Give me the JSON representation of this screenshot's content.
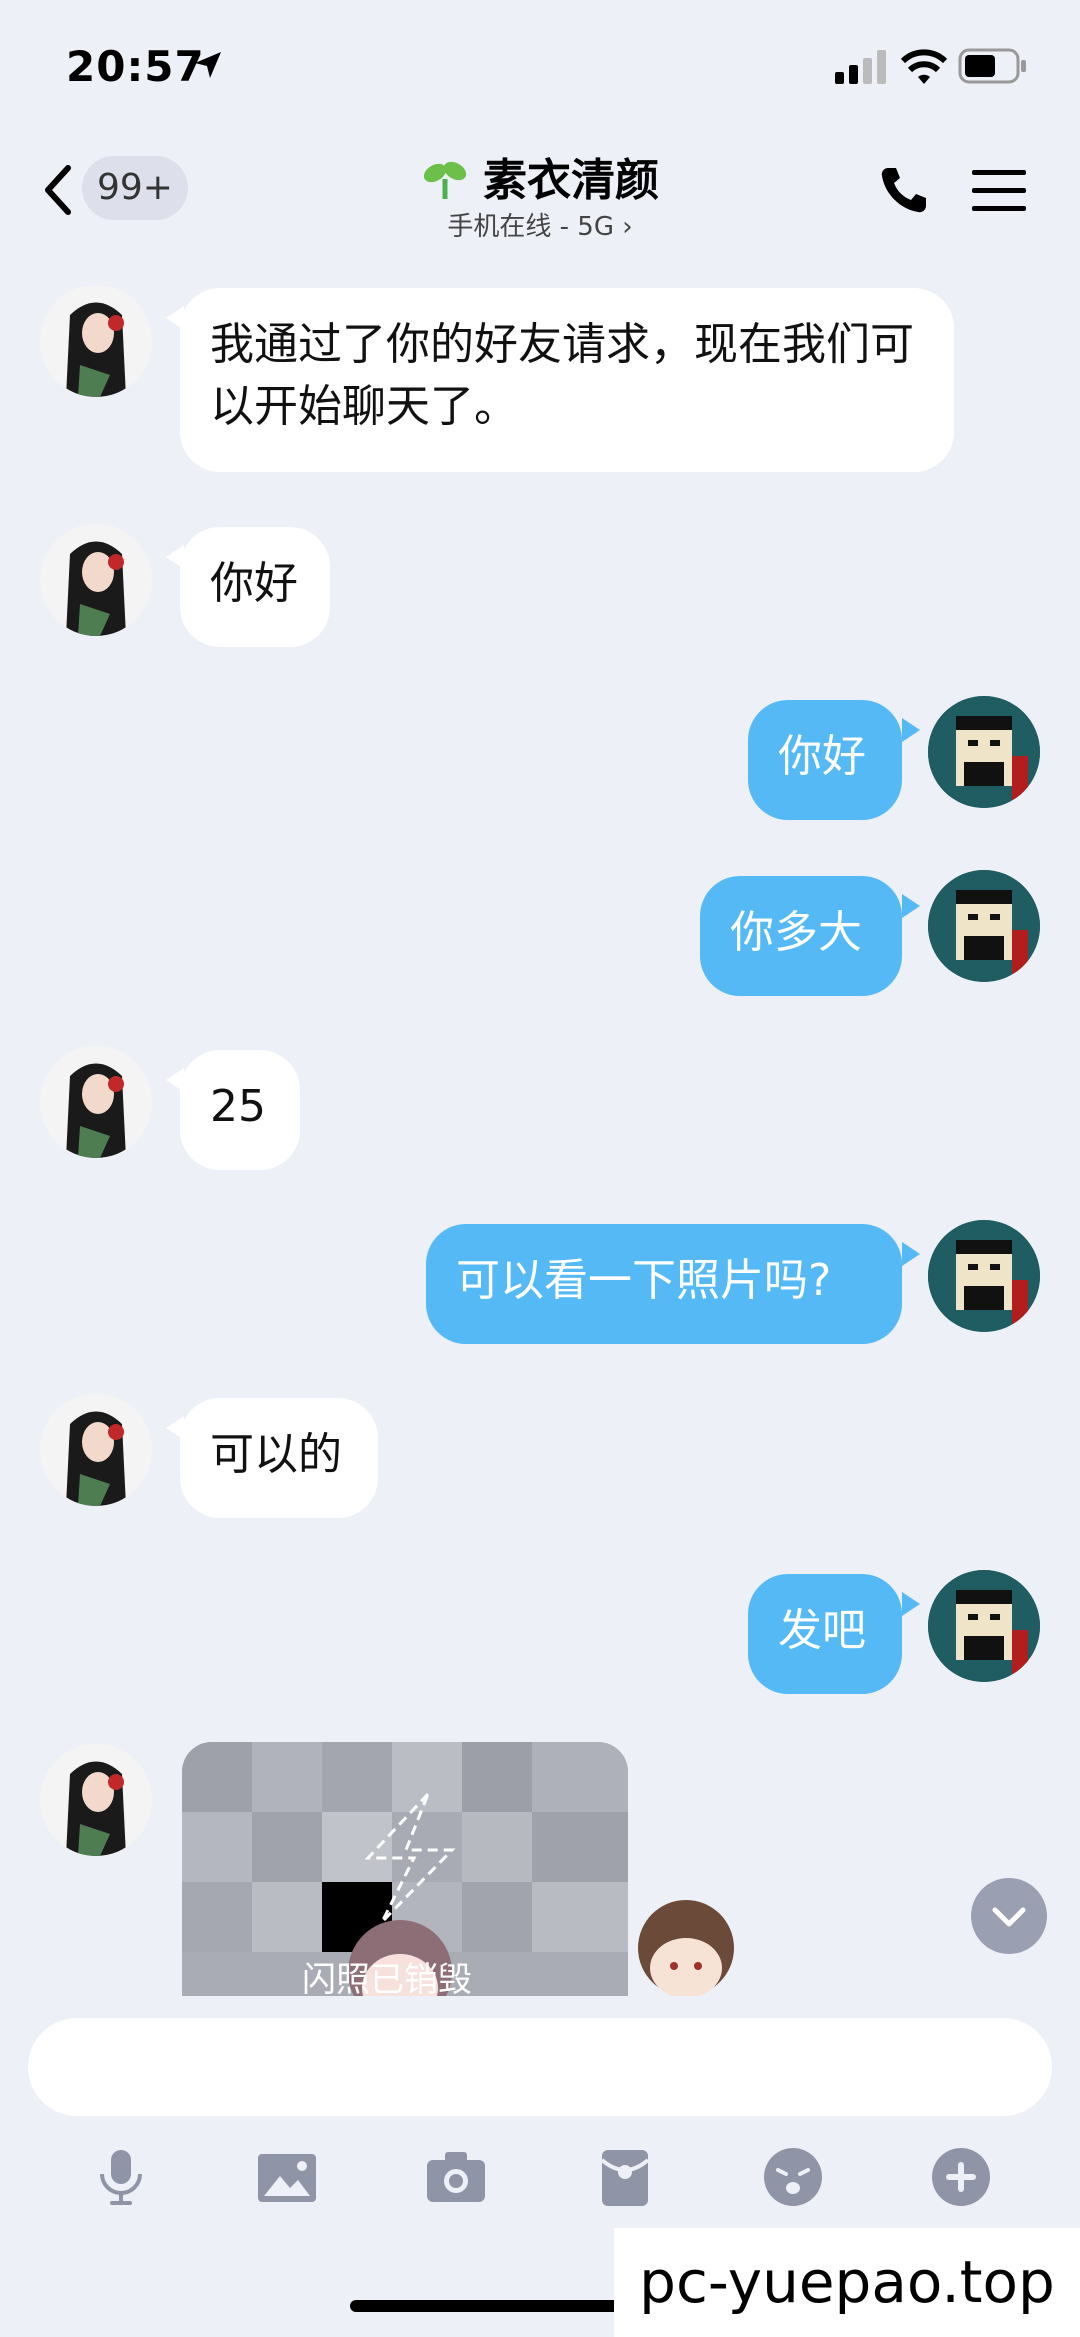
{
  "status": {
    "time": "20:57"
  },
  "header": {
    "badge": "99+",
    "contact_name": "素衣清颜",
    "status_text": "手机在线 - 5G ›"
  },
  "messages": [
    {
      "side": "left",
      "text": "我通过了你的好友请求，现在我们可以开始聊天了。"
    },
    {
      "side": "left",
      "text": "你好"
    },
    {
      "side": "right",
      "text": "你好"
    },
    {
      "side": "right",
      "text": "你多大"
    },
    {
      "side": "left",
      "text": "25"
    },
    {
      "side": "right",
      "text": "可以看一下照片吗?"
    },
    {
      "side": "left",
      "text": "可以的"
    },
    {
      "side": "right",
      "text": "发吧"
    }
  ],
  "flash_image": {
    "label": "闪照已销毁"
  },
  "toolbar": {
    "icons": [
      "microphone-icon",
      "image-icon",
      "camera-icon",
      "red-packet-icon",
      "emoji-icon",
      "plus-icon"
    ]
  },
  "watermark": "pc-yuepao.top",
  "colors": {
    "bubble_self": "#55b9f5",
    "bubble_other": "#ffffff",
    "background": "#eef0f8"
  }
}
